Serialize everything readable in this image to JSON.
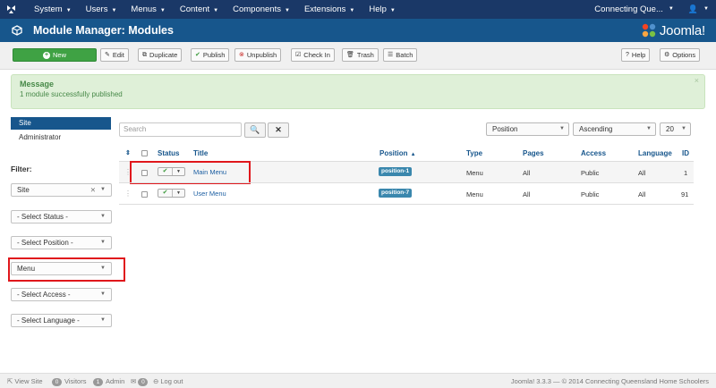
{
  "topnav": {
    "menu": [
      "System",
      "Users",
      "Menus",
      "Content",
      "Components",
      "Extensions",
      "Help"
    ],
    "site_name": "Connecting Que..."
  },
  "header": {
    "title": "Module Manager: Modules",
    "brand": "Joomla!"
  },
  "toolbar": {
    "new": "New",
    "edit": "Edit",
    "duplicate": "Duplicate",
    "publish": "Publish",
    "unpublish": "Unpublish",
    "checkin": "Check In",
    "trash": "Trash",
    "batch": "Batch",
    "help": "Help",
    "options": "Options"
  },
  "message": {
    "heading": "Message",
    "text": "1 module successfully published",
    "close": "×"
  },
  "sidebar": {
    "site": "Site",
    "administrator": "Administrator",
    "filter_label": "Filter:",
    "filters": [
      "Site",
      "- Select Status -",
      "- Select Position -",
      "Menu",
      "- Select Access -",
      "- Select Language -"
    ]
  },
  "search": {
    "placeholder": "Search"
  },
  "list_controls": {
    "ordering": "Position",
    "direction": "Ascending",
    "limit": "20"
  },
  "table": {
    "headers": {
      "status": "Status",
      "title": "Title",
      "position": "Position",
      "type": "Type",
      "pages": "Pages",
      "access": "Access",
      "language": "Language",
      "id": "ID"
    },
    "rows": [
      {
        "title": "Main Menu",
        "position": "position-1",
        "type": "Menu",
        "pages": "All",
        "access": "Public",
        "language": "All",
        "id": "1"
      },
      {
        "title": "User Menu",
        "position": "position-7",
        "type": "Menu",
        "pages": "All",
        "access": "Public",
        "language": "All",
        "id": "91"
      }
    ]
  },
  "footer": {
    "view_site": "View Site",
    "visitors_count": "0",
    "visitors_label": "Visitors",
    "admin_count": "1",
    "admin_label": "Admin",
    "messages_count": "0",
    "logout": "Log out",
    "copyright": "Joomla! 3.3.3 — © 2014 Connecting Queensland Home Schoolers"
  }
}
